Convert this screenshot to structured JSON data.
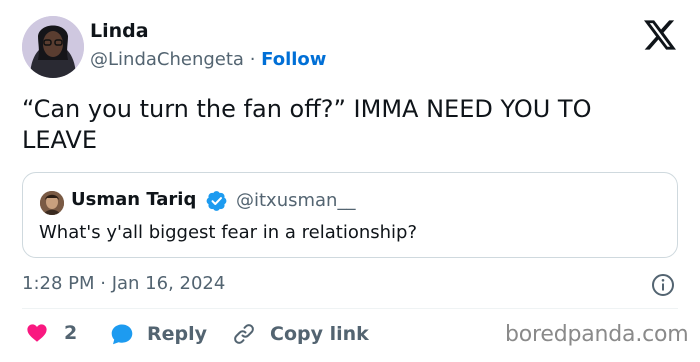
{
  "author": {
    "name": "Linda",
    "handle": "@LindaChengeta",
    "separator": "·",
    "follow_label": "Follow"
  },
  "tweet": {
    "text": "“Can you turn the fan off?” IMMA NEED YOU TO LEAVE"
  },
  "quoted_tweet": {
    "name": "Usman Tariq",
    "handle": "@itxusman__",
    "text": "What's y'all biggest fear in a relationship?"
  },
  "timestamp": "1:28 PM · Jan 16, 2024",
  "actions": {
    "likes_count": "2",
    "reply_label": "Reply",
    "copy_link_label": "Copy link"
  },
  "watermark": "boredpanda.com",
  "colors": {
    "follow_blue": "#006fd6",
    "like_pink": "#f91880",
    "reply_blue": "#1d9bf0",
    "verified_blue": "#1d9bf0",
    "secondary_text": "#536471"
  },
  "icons": [
    "x-logo-icon",
    "verified-badge-icon",
    "info-icon",
    "heart-icon",
    "reply-icon",
    "link-icon"
  ]
}
